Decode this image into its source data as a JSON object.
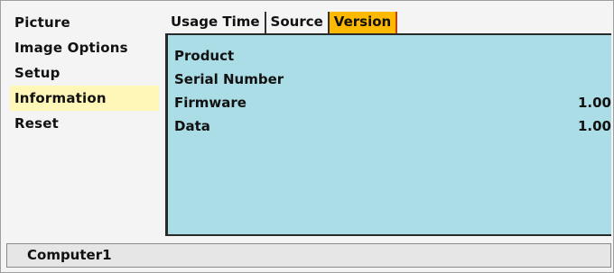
{
  "menu": {
    "items": [
      {
        "label": "Picture",
        "active": false
      },
      {
        "label": "Image Options",
        "active": false
      },
      {
        "label": "Setup",
        "active": false
      },
      {
        "label": "Information",
        "active": true
      },
      {
        "label": "Reset",
        "active": false
      }
    ]
  },
  "tabs": [
    {
      "label": "Usage Time",
      "active": false
    },
    {
      "label": "Source",
      "active": false
    },
    {
      "label": "Version",
      "active": true
    }
  ],
  "panel": {
    "rows": [
      {
        "label": "Product",
        "value": ""
      },
      {
        "label": "Serial Number",
        "value": ""
      },
      {
        "label": "Firmware",
        "value": "1.00"
      },
      {
        "label": "Data",
        "value": "1.00"
      }
    ]
  },
  "status": {
    "source": "Computer1"
  },
  "colors": {
    "active_menu_bg": "#fff7b8",
    "active_tab_bg": "#ffb900",
    "panel_bg": "#abdde7"
  }
}
